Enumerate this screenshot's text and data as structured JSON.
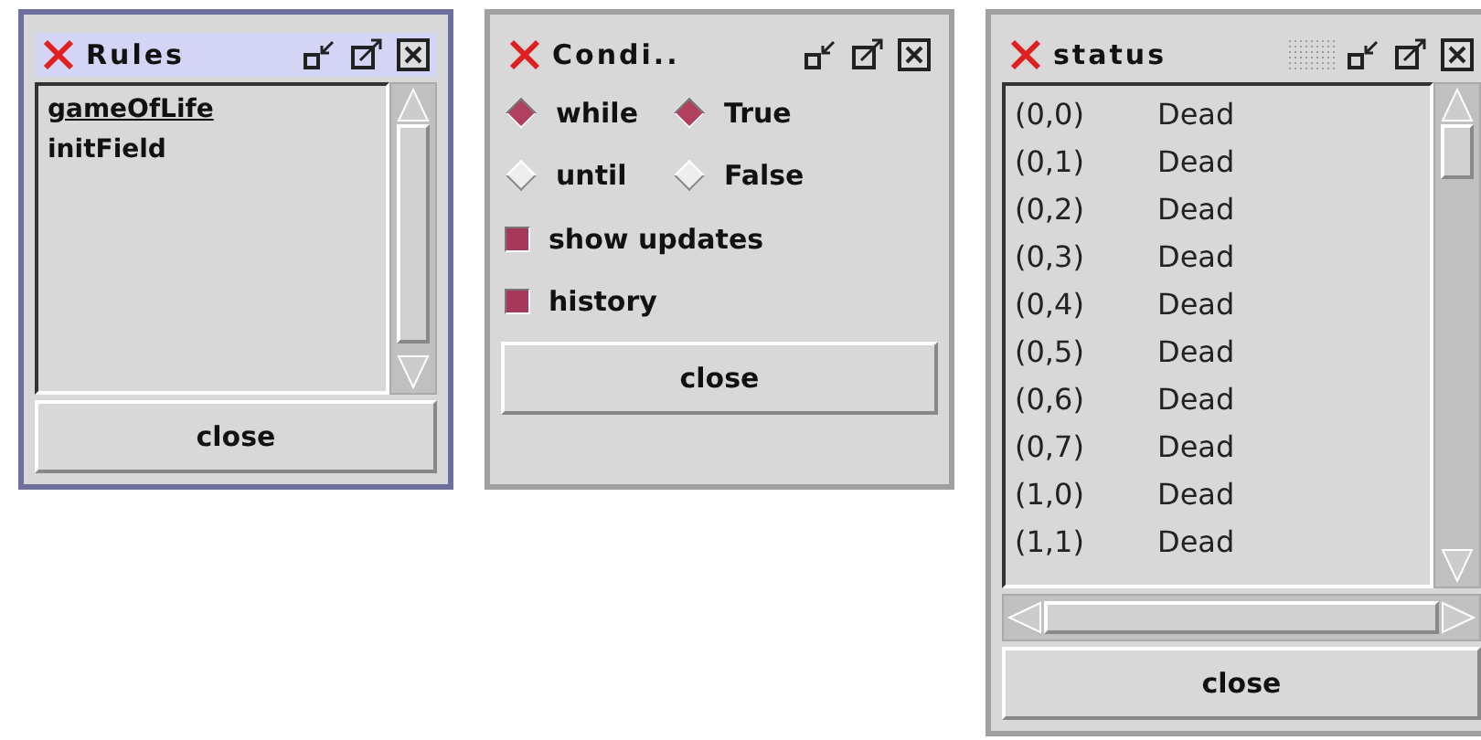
{
  "windows": [
    {
      "kind": "list",
      "title": "Rules",
      "active": true,
      "items": [
        {
          "label": "gameOfLife",
          "selected": true
        },
        {
          "label": "initField",
          "selected": false
        }
      ],
      "button": "close"
    },
    {
      "kind": "conditions",
      "title": "Condi..",
      "active": false,
      "loop": [
        {
          "label": "while",
          "selected": true
        },
        {
          "label": "until",
          "selected": false
        }
      ],
      "truth": [
        {
          "label": "True",
          "selected": true
        },
        {
          "label": "False",
          "selected": false
        }
      ],
      "options": [
        {
          "label": "show updates",
          "checked": true
        },
        {
          "label": "history",
          "checked": true
        }
      ],
      "button": "close"
    },
    {
      "kind": "status",
      "title": "status",
      "active": false,
      "rows": [
        {
          "cell": "(0,0)",
          "state": "Dead"
        },
        {
          "cell": "(0,1)",
          "state": "Dead"
        },
        {
          "cell": "(0,2)",
          "state": "Dead"
        },
        {
          "cell": "(0,3)",
          "state": "Dead"
        },
        {
          "cell": "(0,4)",
          "state": "Dead"
        },
        {
          "cell": "(0,5)",
          "state": "Dead"
        },
        {
          "cell": "(0,6)",
          "state": "Dead"
        },
        {
          "cell": "(0,7)",
          "state": "Dead"
        },
        {
          "cell": "(1,0)",
          "state": "Dead"
        },
        {
          "cell": "(1,1)",
          "state": "Dead"
        }
      ],
      "button": "close"
    }
  ]
}
